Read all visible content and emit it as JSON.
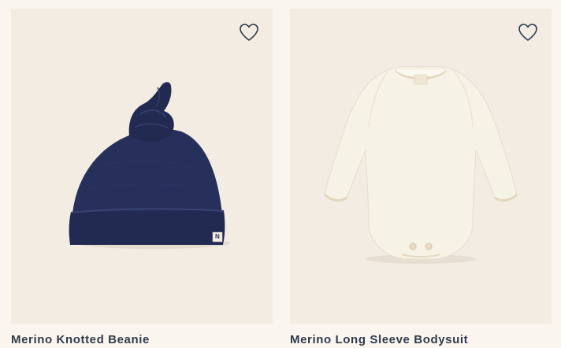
{
  "products": [
    {
      "title": "Merino Knotted Beanie",
      "wishlist_icon": "heart-outline-icon",
      "image": "navy-knotted-beanie",
      "label_letter": "N"
    },
    {
      "title": "Merino Long Sleeve Bodysuit",
      "wishlist_icon": "heart-outline-icon",
      "image": "cream-long-sleeve-bodysuit"
    }
  ],
  "colors": {
    "page_bg": "#faf6ef",
    "card_bg": "#f2ece3",
    "title_text": "#2f3a4a",
    "beanie": "#27305a",
    "bodysuit": "#f7f2e6"
  }
}
